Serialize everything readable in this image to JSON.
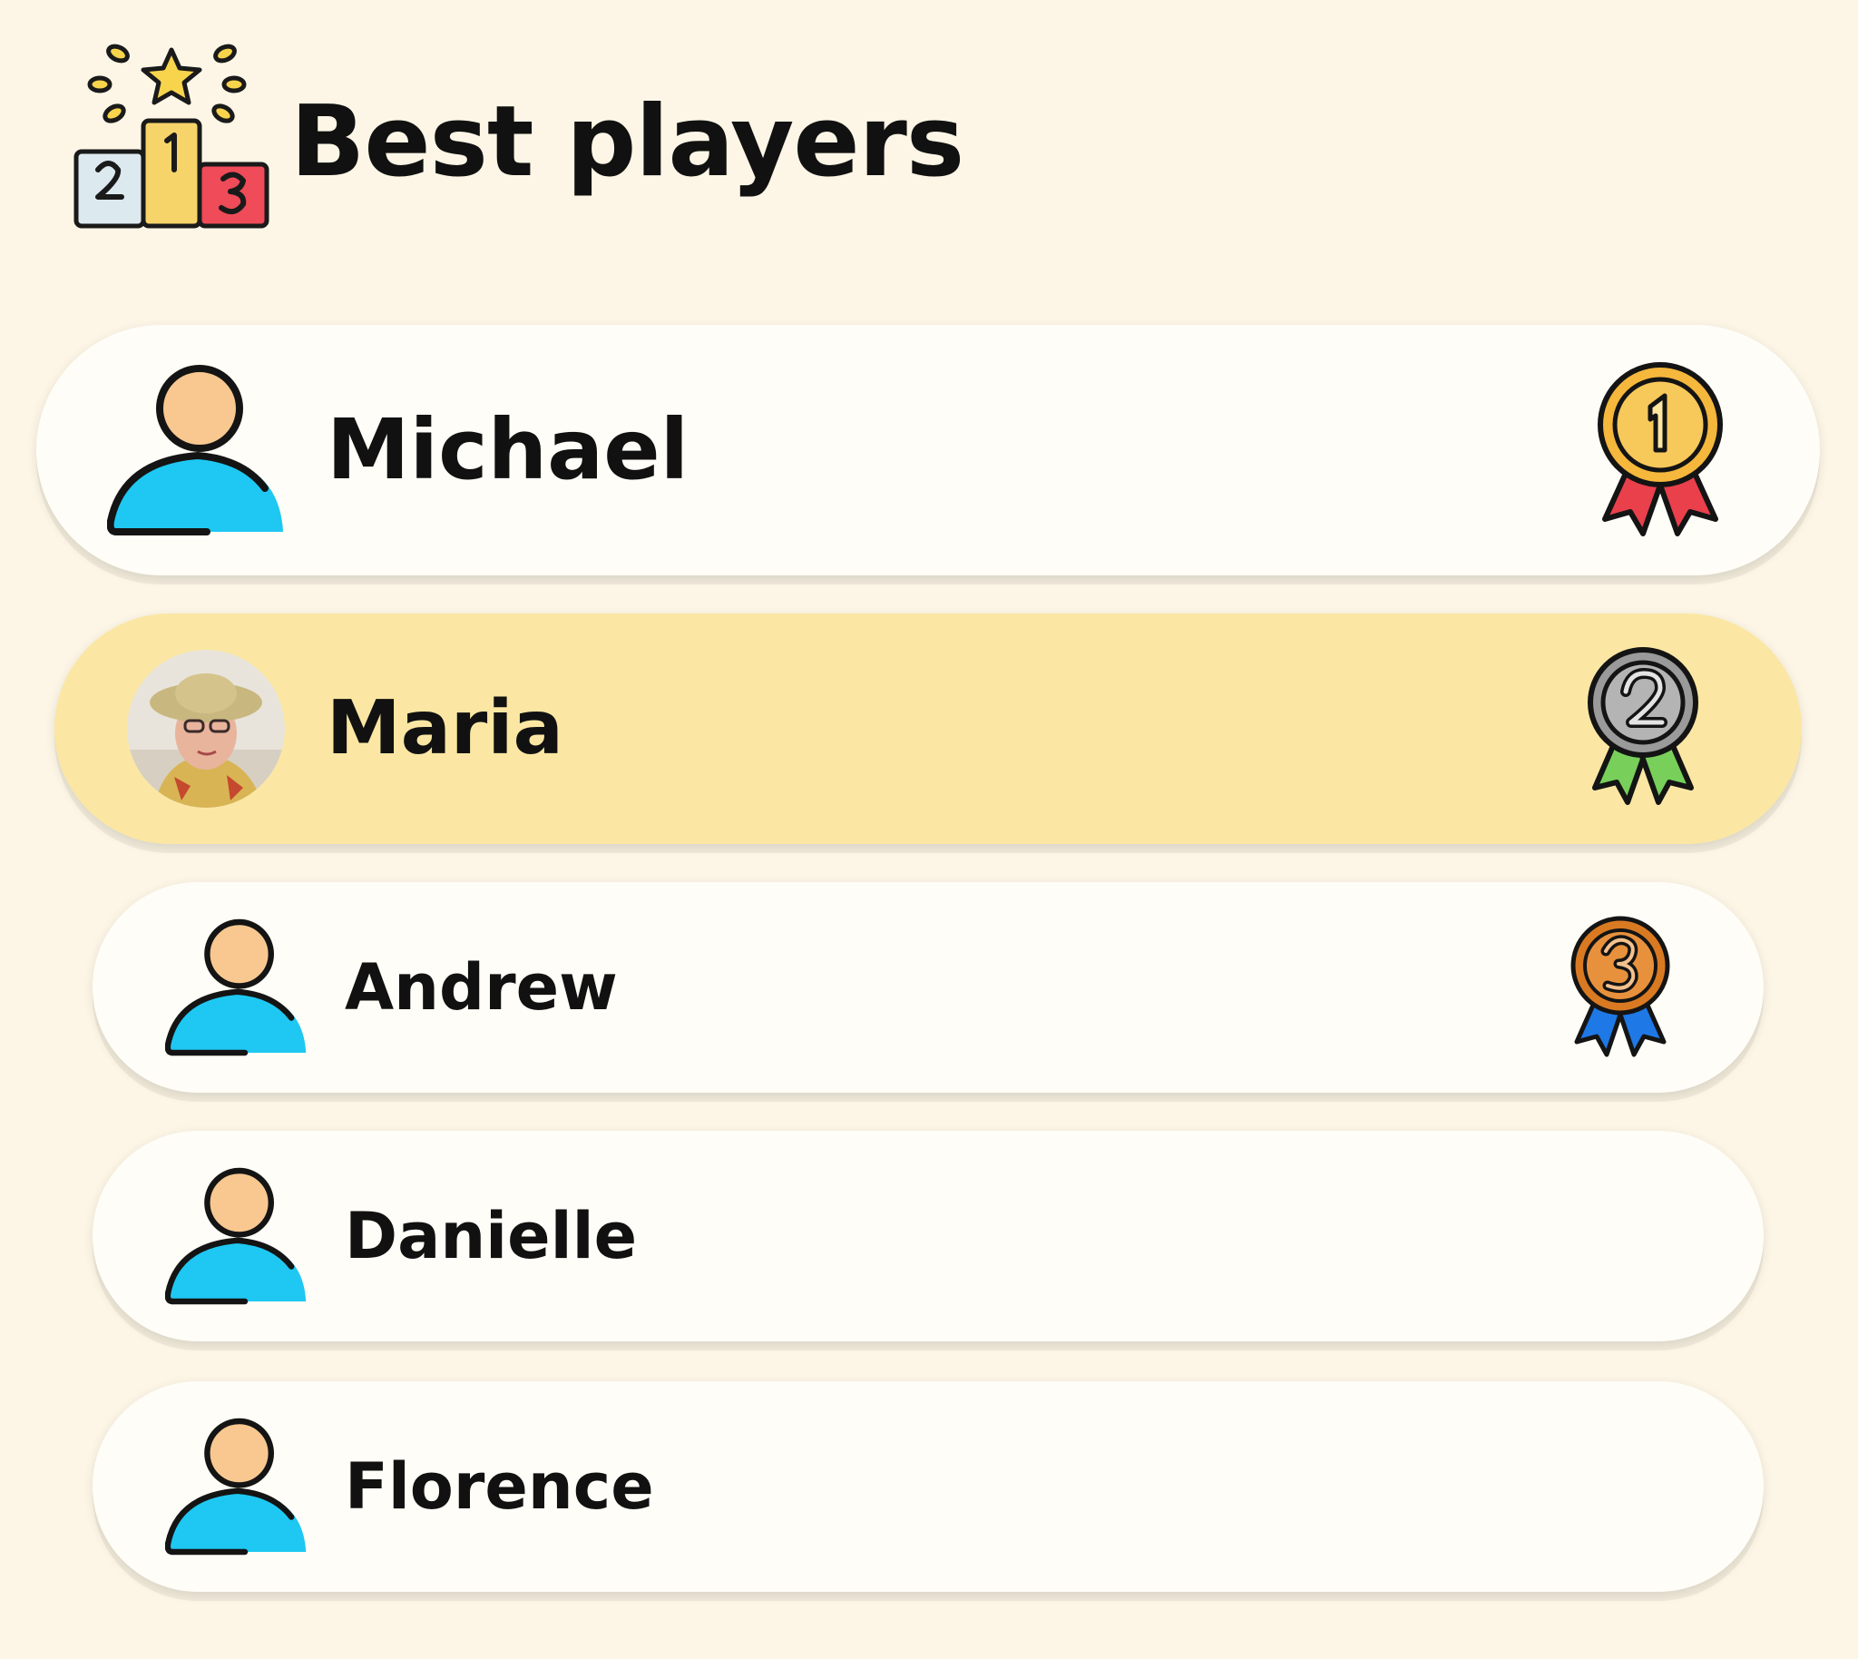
{
  "header": {
    "title": "Best players",
    "icon": "podium-icon"
  },
  "players": [
    {
      "name": "Michael",
      "avatar": "user-icon",
      "medal": "1"
    },
    {
      "name": "Maria",
      "avatar": "profile-photo",
      "medal": "2",
      "highlighted": true
    },
    {
      "name": "Andrew",
      "avatar": "user-icon",
      "medal": "3"
    },
    {
      "name": "Danielle",
      "avatar": "user-icon"
    },
    {
      "name": "Florence",
      "avatar": "user-icon"
    }
  ],
  "colors": {
    "background": "#fdf6e6",
    "row": "#fffdf7",
    "highlight_row": "#fbe7a3",
    "avatar_body": "#1ec8f2",
    "avatar_head": "#f8c890",
    "gold": "#f5b73c",
    "silver": "#9a9a9a",
    "bronze": "#d97a22",
    "ribbon_red": "#e9404b",
    "ribbon_green": "#78d05a",
    "ribbon_blue": "#1e78e6"
  }
}
